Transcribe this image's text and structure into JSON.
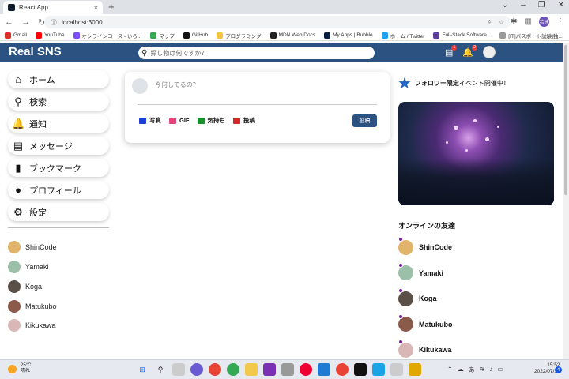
{
  "browser": {
    "tab_title": "React App",
    "tab_close": "×",
    "new_tab": "+",
    "url": "localhost:3000",
    "profile_initials": "若達",
    "bookmarks": [
      {
        "label": "Gmail",
        "color": "#d93025"
      },
      {
        "label": "YouTube",
        "color": "#ff0000"
      },
      {
        "label": "オンラインコース - いろ...",
        "color": "#7c4dff"
      },
      {
        "label": "マップ",
        "color": "#34a853"
      },
      {
        "label": "GitHub",
        "color": "#111111"
      },
      {
        "label": "プログラミング",
        "color": "#f4c542"
      },
      {
        "label": "MDN Web Docs",
        "color": "#222222"
      },
      {
        "label": "My Apps | Bubble",
        "color": "#0a1f44"
      },
      {
        "label": "ホーム / Twitter",
        "color": "#1da1f2"
      },
      {
        "label": "Full-Stack Software...",
        "color": "#5a3d9a"
      },
      {
        "label": "[IT]パスポート試験]独...",
        "color": "#999999"
      }
    ]
  },
  "app": {
    "logo": "Real SNS",
    "search_placeholder": "探し物は何ですか？",
    "chat_badge": "1",
    "notif_badge": "2"
  },
  "sidebar": {
    "items": [
      {
        "label": "ホーム",
        "icon": "home-icon",
        "glyph": "⌂"
      },
      {
        "label": "検索",
        "icon": "search-icon",
        "glyph": "⚲"
      },
      {
        "label": "通知",
        "icon": "bell-icon",
        "glyph": "🔔"
      },
      {
        "label": "メッセージ",
        "icon": "chat-icon",
        "glyph": "▤"
      },
      {
        "label": "ブックマーク",
        "icon": "bookmark-icon",
        "glyph": "▮"
      },
      {
        "label": "プロフィール",
        "icon": "person-icon",
        "glyph": "●"
      },
      {
        "label": "設定",
        "icon": "gear-icon",
        "glyph": "⚙"
      }
    ],
    "friends": [
      {
        "name": "ShinCode",
        "color": "#e0b46a"
      },
      {
        "name": "Yamaki",
        "color": "#9bbfa8"
      },
      {
        "name": "Koga",
        "color": "#5a5048"
      },
      {
        "name": "Matukubo",
        "color": "#8a5a4a"
      },
      {
        "name": "Kikukawa",
        "color": "#d9b7b7"
      }
    ]
  },
  "share": {
    "placeholder": "今何してるの？",
    "options": [
      {
        "label": "写真",
        "icon": "photo-icon",
        "color": "#1e3fd6"
      },
      {
        "label": "GIF",
        "icon": "gif-icon",
        "color": "#e0447a"
      },
      {
        "label": "気持ち",
        "icon": "mood-icon",
        "color": "#1a8f2e"
      },
      {
        "label": "投稿",
        "icon": "post-icon",
        "color": "#d62828"
      }
    ],
    "submit_label": "投稿"
  },
  "rightbar": {
    "event_bold": "フォロワー限定",
    "event_text": "イベント開催中！",
    "online_title": "オンラインの友達",
    "online_friends": [
      {
        "name": "ShinCode",
        "color": "#e0b46a"
      },
      {
        "name": "Yamaki",
        "color": "#9bbfa8"
      },
      {
        "name": "Koga",
        "color": "#5a5048"
      },
      {
        "name": "Matukubo",
        "color": "#8a5a4a"
      },
      {
        "name": "Kikukawa",
        "color": "#d9b7b7"
      }
    ]
  },
  "taskbar": {
    "temp": "25°C",
    "weather": "晴れ",
    "ime": "あ",
    "time": "15:52",
    "date": "2022/07/14",
    "notif_count": "4"
  }
}
